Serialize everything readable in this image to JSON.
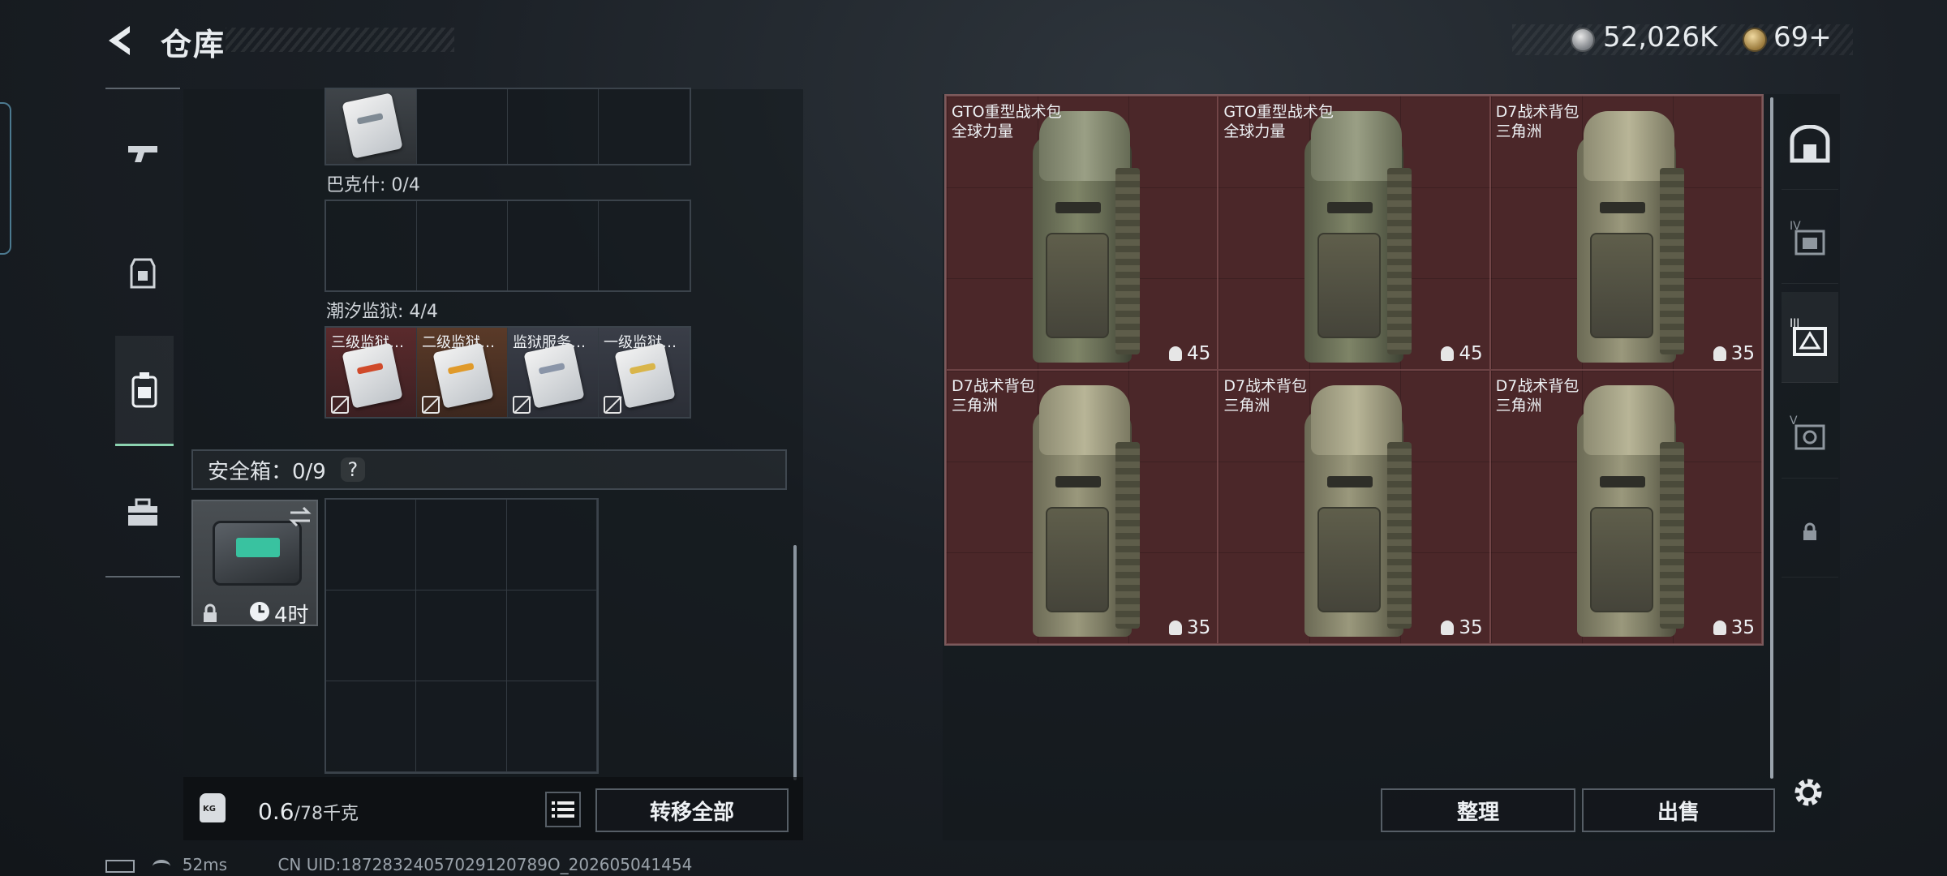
{
  "header": {
    "title": "仓库",
    "currency_silver": "52,026K",
    "currency_gold": "69+"
  },
  "storage": {
    "row_labels": [
      "巴克什: 0/4",
      "潮汐监狱: 4/4"
    ],
    "keys": [
      {
        "name": "三级监狱…",
        "tint": "red",
        "stripe": "#d04a2a"
      },
      {
        "name": "二级监狱…",
        "tint": "orange",
        "stripe": "#e09a2a"
      },
      {
        "name": "监狱服务…",
        "tint": "gray",
        "stripe": "#8a95a8"
      },
      {
        "name": "一级监狱…",
        "tint": "gray",
        "stripe": "#d9b54a"
      }
    ],
    "safe_label": "安全箱：0/9",
    "help": "?",
    "safe_timer": "4时",
    "weight_value": "0.6",
    "weight_max": "/78千克",
    "transfer_all": "转移全部"
  },
  "container": {
    "items": [
      {
        "name": "GTO重型战术包",
        "sub": "全球力量",
        "capacity": "45",
        "style": "olive"
      },
      {
        "name": "GTO重型战术包",
        "sub": "全球力量",
        "capacity": "45",
        "style": "olive"
      },
      {
        "name": "D7战术背包",
        "sub": "三角洲",
        "capacity": "35",
        "style": "tan"
      },
      {
        "name": "D7战术背包",
        "sub": "三角洲",
        "capacity": "35",
        "style": "tan"
      },
      {
        "name": "D7战术背包",
        "sub": "三角洲",
        "capacity": "35",
        "style": "tan"
      },
      {
        "name": "D7战术背包",
        "sub": "三角洲",
        "capacity": "35",
        "style": "tan"
      }
    ],
    "sort_label": "整理",
    "sell_label": "出售"
  },
  "right_nav": [
    "IV",
    "III",
    "V"
  ],
  "status": {
    "ping": "52ms",
    "uid": "CN UID:18728324057029120789O_202605041454"
  },
  "colors": {
    "accent": "#8cd3b0",
    "item_bg": "#4b2729"
  }
}
